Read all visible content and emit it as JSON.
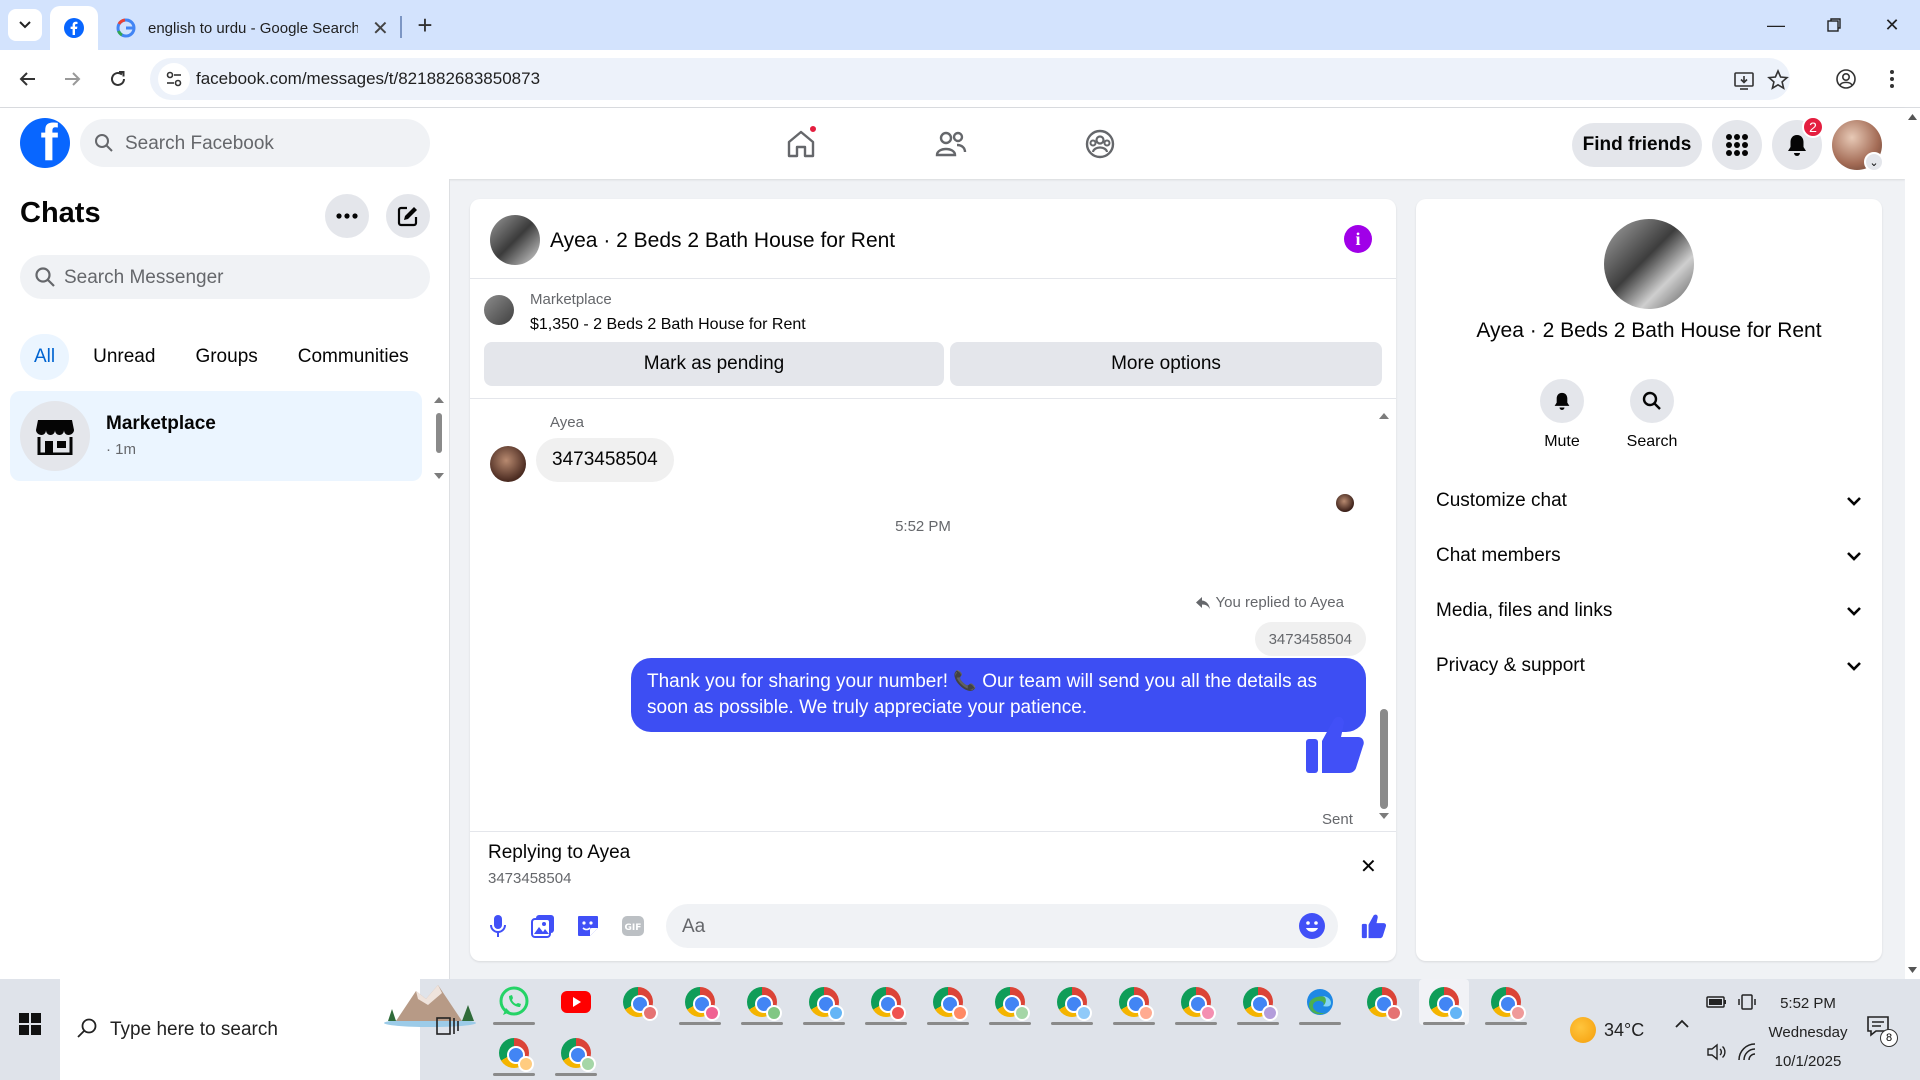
{
  "browser": {
    "tabs": [
      {
        "title": "",
        "favicon": "facebook-icon",
        "active": true
      },
      {
        "title": "english to urdu - Google Search",
        "favicon": "google-icon",
        "active": false
      }
    ],
    "url": "facebook.com/messages/t/821882683850873"
  },
  "fb_header": {
    "search_placeholder": "Search Facebook",
    "find_friends_label": "Find friends",
    "notifications_count": "2",
    "colors": {
      "brand": "#0866ff",
      "badge": "#e41e3f"
    }
  },
  "chats": {
    "title": "Chats",
    "search_placeholder": "Search Messenger",
    "filters": [
      "All",
      "Unread",
      "Groups",
      "Communities"
    ],
    "active_filter": "All",
    "items": [
      {
        "name": "Marketplace",
        "meta": "· 1m"
      }
    ]
  },
  "conversation": {
    "title": "Ayea · 2 Beds 2 Bath House for Rent",
    "listing": {
      "source": "Marketplace",
      "title": "$1,350 - 2 Beds 2 Bath House for Rent",
      "mark_pending_label": "Mark as pending",
      "more_options_label": "More options"
    },
    "messages": {
      "received_sender": "Ayea",
      "received_text": "3473458504",
      "timestamp": "5:52 PM",
      "reply_note": "You replied to Ayea",
      "quoted_text": "3473458504",
      "sent_text": "Thank you for sharing your number! 📞 Our team will send you all the details as soon as possible. We truly appreciate your patience.",
      "sent_status": "Sent"
    },
    "reply_bar": {
      "title": "Replying to Ayea",
      "text": "3473458504"
    },
    "composer_placeholder": "Aa",
    "colors": {
      "sent_bubble": "#3d4ef3",
      "accent": "#4150f7",
      "info": "#a000e8"
    }
  },
  "details": {
    "title": "Ayea · 2 Beds 2 Bath House for Rent",
    "actions": [
      {
        "label": "Mute",
        "icon": "bell-icon"
      },
      {
        "label": "Search",
        "icon": "search-icon"
      }
    ],
    "sections": [
      "Customize chat",
      "Chat members",
      "Media, files and links",
      "Privacy & support"
    ]
  },
  "taskbar": {
    "search_placeholder": "Type here to search",
    "weather": "34°C",
    "time": "5:52 PM",
    "day": "Wednesday",
    "date": "10/1/2025",
    "notification_count": "8"
  }
}
